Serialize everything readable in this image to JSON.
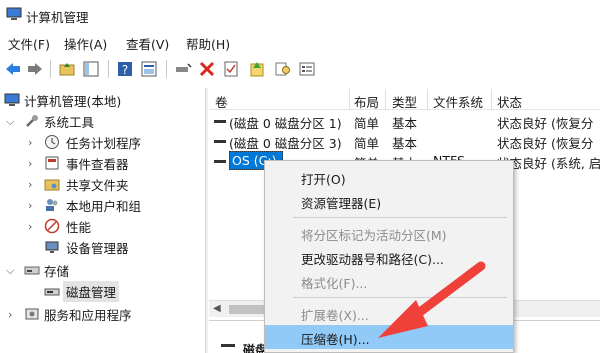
{
  "window": {
    "title": "计算机管理"
  },
  "menu": [
    "文件(F)",
    "操作(A)",
    "查看(V)",
    "帮助(H)"
  ],
  "tree": {
    "root": "计算机管理(本地)",
    "system_tools": "系统工具",
    "task_scheduler": "任务计划程序",
    "event_viewer": "事件查看器",
    "shared_folders": "共享文件夹",
    "local_users": "本地用户和组",
    "performance": "性能",
    "device_manager": "设备管理器",
    "storage": "存储",
    "disk_management": "磁盘管理",
    "services_apps": "服务和应用程序"
  },
  "list": {
    "headers": [
      "卷",
      "布局",
      "类型",
      "文件系统",
      "状态"
    ],
    "rows": [
      {
        "volume": "(磁盘 0 磁盘分区 1)",
        "layout": "简单",
        "type": "基本",
        "fs": "",
        "status": "状态良好 (恢复分"
      },
      {
        "volume": "(磁盘 0 磁盘分区 3)",
        "layout": "简单",
        "type": "基本",
        "fs": "",
        "status": "状态良好 (恢复分"
      },
      {
        "volume": "OS (C:)",
        "layout": "简单",
        "type": "基本",
        "fs": "NTFS",
        "status": "状态良好 (系统, 启"
      }
    ]
  },
  "lower": {
    "disk_label": "磁盘"
  },
  "context_menu": {
    "open": "打开(O)",
    "explorer": "资源管理器(E)",
    "mark_active": "将分区标记为活动分区(M)",
    "change_letter": "更改驱动器号和路径(C)...",
    "format": "格式化(F)...",
    "extend": "扩展卷(X)...",
    "shrink": "压缩卷(H)..."
  },
  "colors": {
    "selection": "#0078d7",
    "menu_highlight": "#91c9f7",
    "annotation_arrow": "#f0403a"
  }
}
